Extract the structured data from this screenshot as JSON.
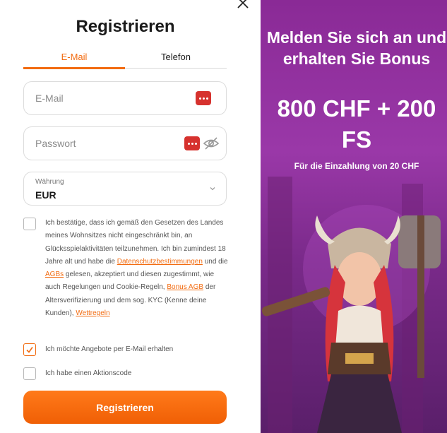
{
  "title": "Registrieren",
  "tabs": [
    {
      "label": "E-Mail",
      "active": true
    },
    {
      "label": "Telefon",
      "active": false
    }
  ],
  "fields": {
    "email": {
      "placeholder": "E-Mail",
      "value": ""
    },
    "password": {
      "placeholder": "Passwort",
      "value": ""
    },
    "currency": {
      "label": "Währung",
      "value": "EUR"
    }
  },
  "consent": {
    "part1": "Ich bestätige, dass ich gemäß den Gesetzen des Landes meines Wohnsitzes nicht eingeschränkt bin, an Glücksspielaktivitäten teilzunehmen. Ich bin zumindest 18 Jahre alt und habe die ",
    "link_privacy": "Datenschutzbestimmungen",
    "part2": " und die ",
    "link_agb": "AGBs",
    "part3": " gelesen, akzeptiert und diesen zugestimmt, wie auch Regelungen und Cookie-Regeln, ",
    "link_bonus": "Bonus AGB",
    "part4": " der Altersverifizierung und dem sog. KYC (Kenne deine Kunden), ",
    "link_bet": "Wettregeln",
    "checked": false
  },
  "offers": {
    "label": "Ich möchte Angebote per E-Mail erhalten",
    "checked": true
  },
  "promo_code": {
    "label": "Ich habe einen Aktionscode",
    "checked": false
  },
  "register_button": "Registrieren",
  "promo": {
    "headline": "Melden Sie sich an und erhalten Sie Bonus",
    "bonus": "800 CHF + 200 FS",
    "subtitle": "Für die Einzahlung von 20 CHF"
  },
  "colors": {
    "accent": "#f26b10",
    "promo_bg": "#8a2a96"
  }
}
